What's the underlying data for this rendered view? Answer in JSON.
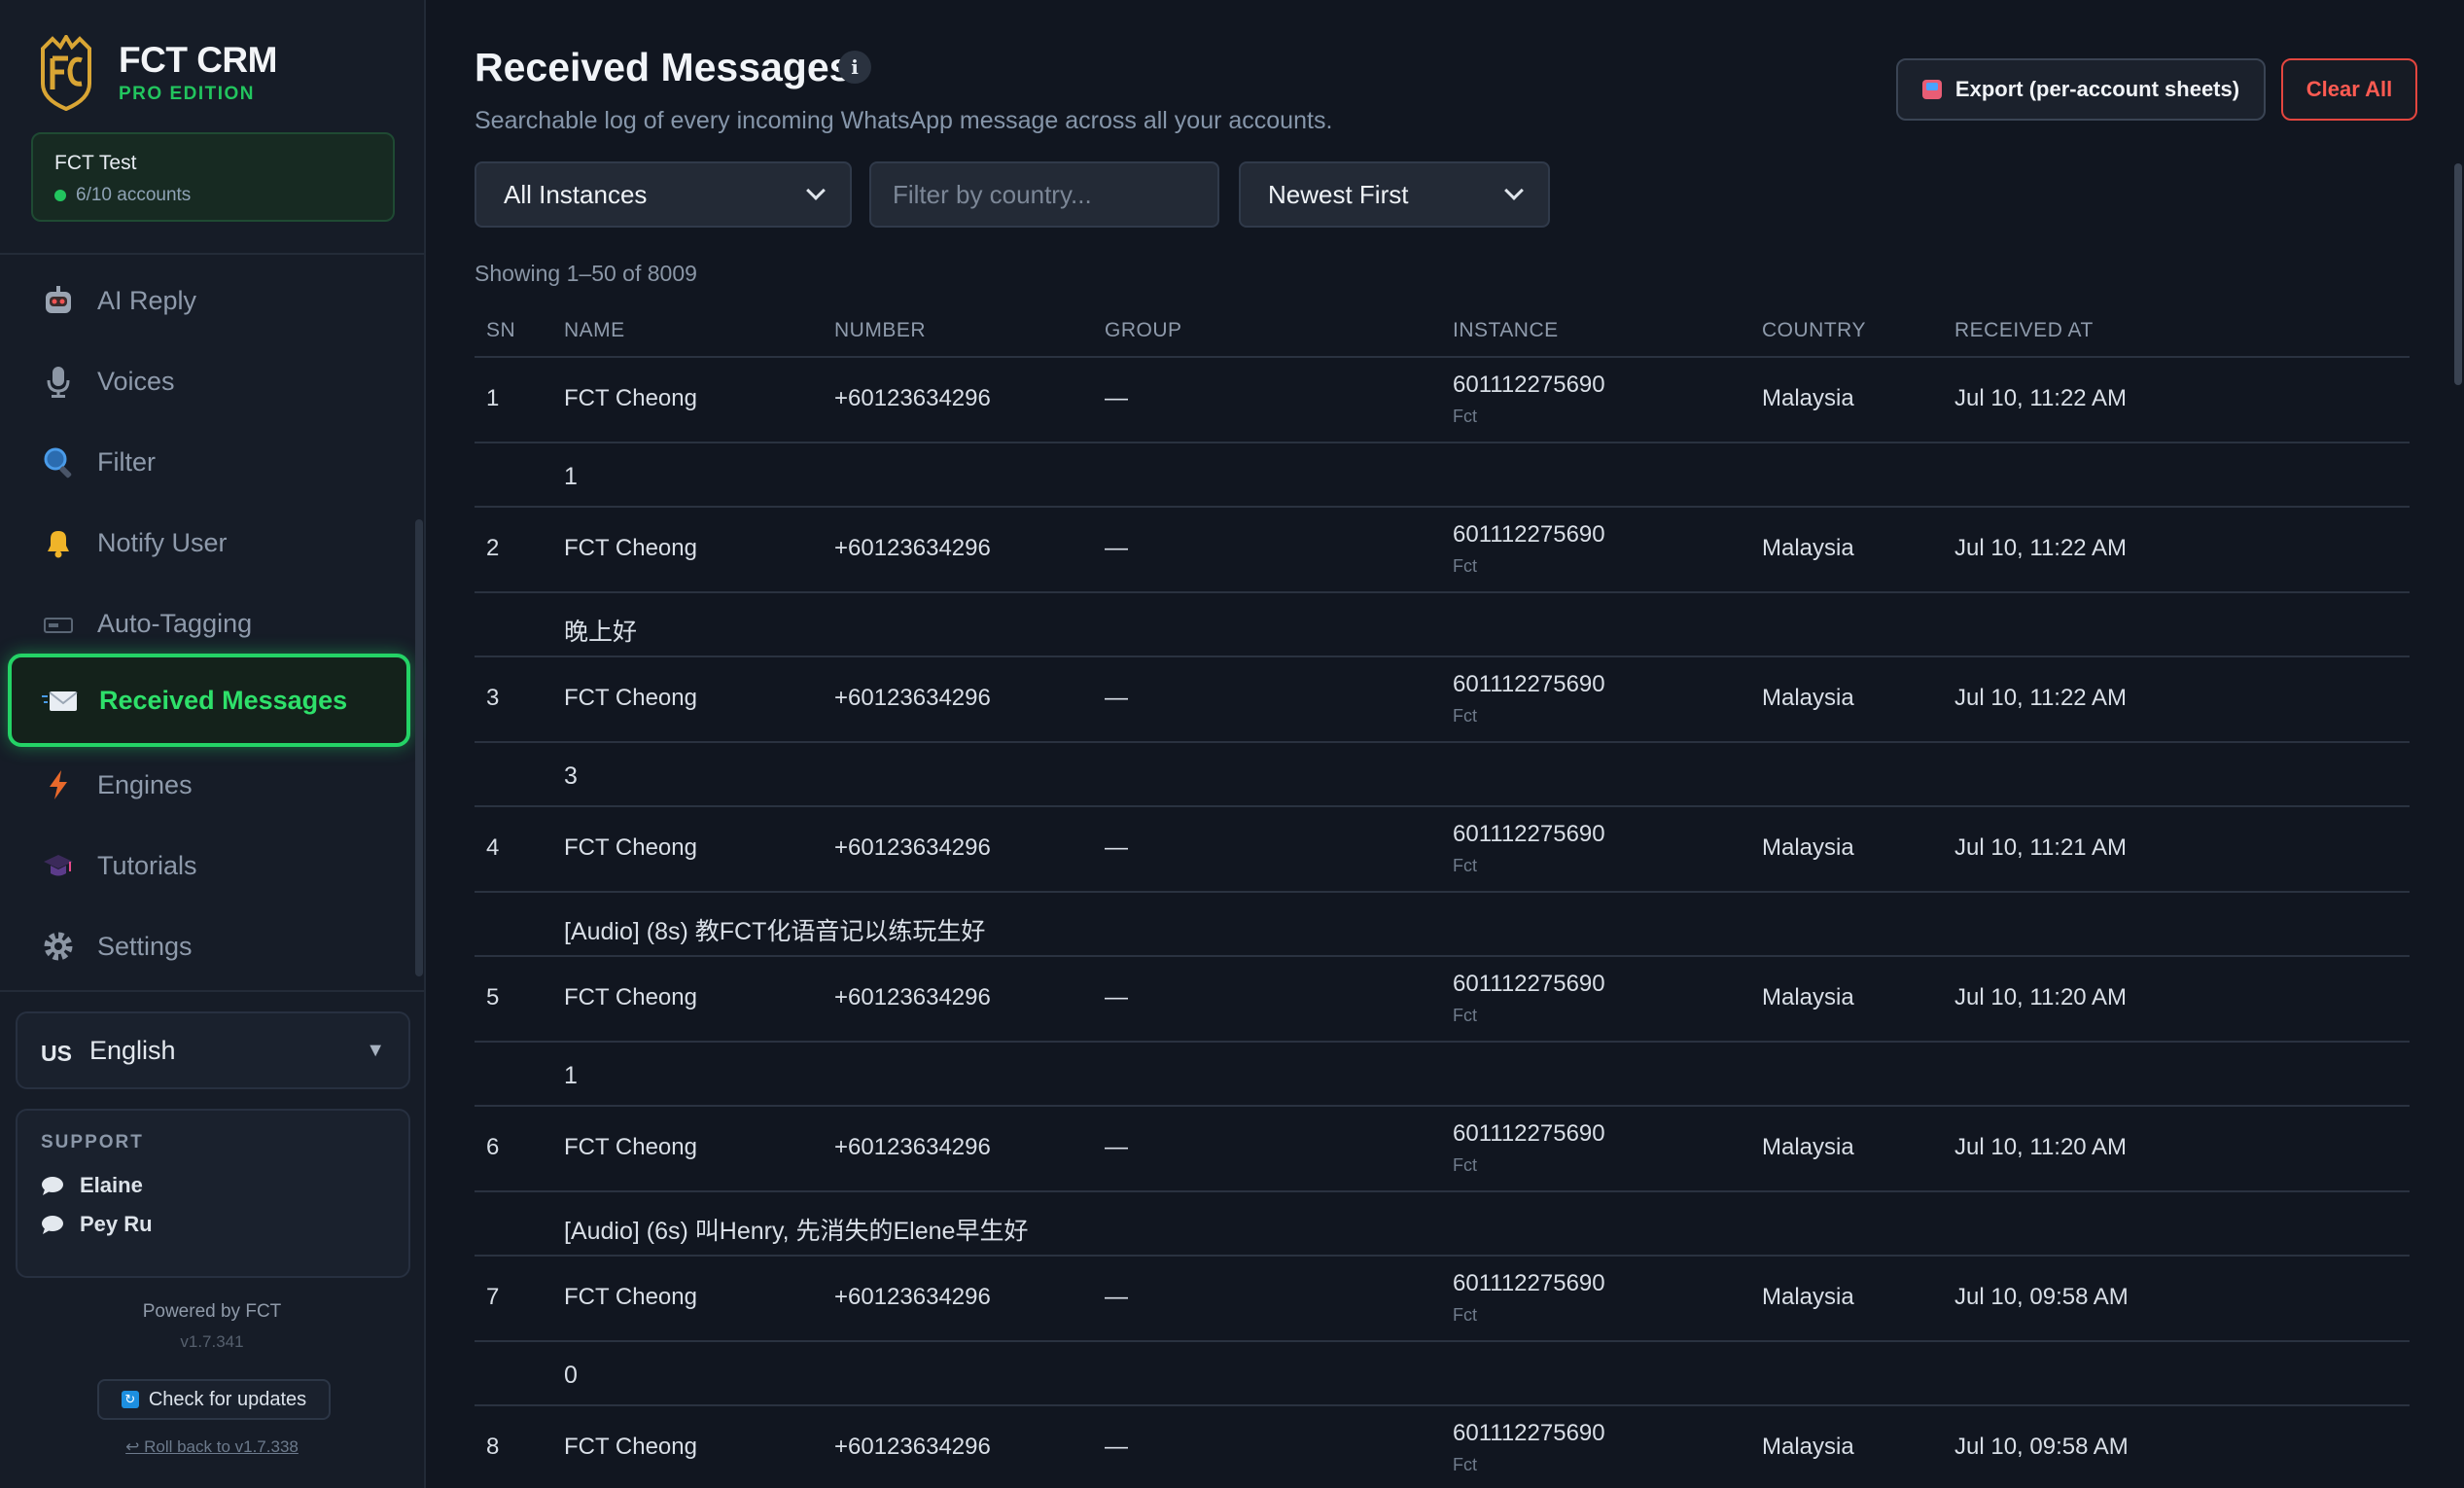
{
  "brand": {
    "title": "FCT CRM",
    "edition": "PRO EDITION"
  },
  "account": {
    "name": "FCT Test",
    "count": "6/10 accounts"
  },
  "nav": [
    {
      "label": "AI Reply",
      "icon": "robot-icon"
    },
    {
      "label": "Voices",
      "icon": "microphone-icon"
    },
    {
      "label": "Filter",
      "icon": "magnifier-icon"
    },
    {
      "label": "Notify User",
      "icon": "bell-icon"
    },
    {
      "label": "Auto-Tagging",
      "icon": "tag-icon"
    },
    {
      "label": "Received Messages",
      "icon": "envelope-icon",
      "active": true
    },
    {
      "label": "Engines",
      "icon": "lightning-icon"
    },
    {
      "label": "Tutorials",
      "icon": "graduation-cap-icon"
    },
    {
      "label": "Settings",
      "icon": "gear-icon"
    }
  ],
  "language": {
    "code": "US",
    "name": "English",
    "caret": "▼"
  },
  "support": {
    "title": "SUPPORT",
    "contacts": [
      "Elaine",
      "Pey Ru"
    ]
  },
  "footer": {
    "powered": "Powered by FCT",
    "version": "v1.7.341",
    "update_label": "Check for updates",
    "rollback_label": "↩ Roll back to v1.7.338"
  },
  "header": {
    "title": "Received Messages",
    "info": "i",
    "subtitle": "Searchable log of every incoming WhatsApp message across all your accounts."
  },
  "actions": {
    "export_label": "Export (per-account sheets)",
    "clear_label": "Clear All"
  },
  "filters": {
    "instance_selected": "All Instances",
    "country_placeholder": "Filter by country...",
    "sort_selected": "Newest First"
  },
  "showing": "Showing 1–50 of 8009",
  "columns": [
    "SN",
    "NAME",
    "NUMBER",
    "GROUP",
    "INSTANCE",
    "COUNTRY",
    "RECEIVED AT"
  ],
  "rows": [
    {
      "sn": "1",
      "name": "FCT Cheong",
      "number": "+60123634296",
      "group": "—",
      "instance": "601112275690",
      "instance_name": "Fct",
      "country": "Malaysia",
      "received": "Jul 10, 11:22 AM",
      "message": "1"
    },
    {
      "sn": "2",
      "name": "FCT Cheong",
      "number": "+60123634296",
      "group": "—",
      "instance": "601112275690",
      "instance_name": "Fct",
      "country": "Malaysia",
      "received": "Jul 10, 11:22 AM",
      "message": "晚上好"
    },
    {
      "sn": "3",
      "name": "FCT Cheong",
      "number": "+60123634296",
      "group": "—",
      "instance": "601112275690",
      "instance_name": "Fct",
      "country": "Malaysia",
      "received": "Jul 10, 11:22 AM",
      "message": "3"
    },
    {
      "sn": "4",
      "name": "FCT Cheong",
      "number": "+60123634296",
      "group": "—",
      "instance": "601112275690",
      "instance_name": "Fct",
      "country": "Malaysia",
      "received": "Jul 10, 11:21 AM",
      "message": "[Audio] (8s) 教FCT化语音记以练玩生好"
    },
    {
      "sn": "5",
      "name": "FCT Cheong",
      "number": "+60123634296",
      "group": "—",
      "instance": "601112275690",
      "instance_name": "Fct",
      "country": "Malaysia",
      "received": "Jul 10, 11:20 AM",
      "message": "1"
    },
    {
      "sn": "6",
      "name": "FCT Cheong",
      "number": "+60123634296",
      "group": "—",
      "instance": "601112275690",
      "instance_name": "Fct",
      "country": "Malaysia",
      "received": "Jul 10, 11:20 AM",
      "message": "[Audio] (6s) 叫Henry, 先消失的Elene早生好"
    },
    {
      "sn": "7",
      "name": "FCT Cheong",
      "number": "+60123634296",
      "group": "—",
      "instance": "601112275690",
      "instance_name": "Fct",
      "country": "Malaysia",
      "received": "Jul 10, 09:58 AM",
      "message": "0"
    },
    {
      "sn": "8",
      "name": "FCT Cheong",
      "number": "+60123634296",
      "group": "—",
      "instance": "601112275690",
      "instance_name": "Fct",
      "country": "Malaysia",
      "received": "Jul 10, 09:58 AM",
      "message": ""
    }
  ]
}
